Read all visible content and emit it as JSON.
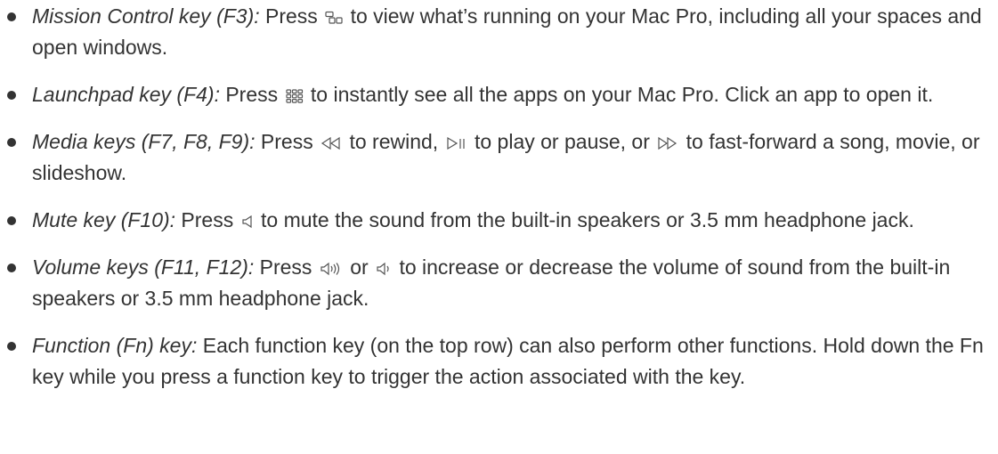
{
  "items": [
    {
      "term": "Mission Control key (F3):",
      "before": " Press ",
      "icon": "mission-control-icon",
      "after": " to view what’s running on your Mac Pro, including all your spaces and open windows."
    },
    {
      "term": "Launchpad key (F4):",
      "before": " Press ",
      "icon": "launchpad-icon",
      "after": " to instantly see all the apps on your Mac Pro. Click an app to open it."
    },
    {
      "term": "Media keys (F7, F8, F9):",
      "before": " Press ",
      "icon1": "rewind-icon",
      "mid1": " to rewind, ",
      "icon2": "play-pause-icon",
      "mid2": " to play or pause, or ",
      "icon3": "fast-forward-icon",
      "after": " to fast-forward a song, movie, or slideshow."
    },
    {
      "term": "Mute key (F10):",
      "before": " Press ",
      "icon": "mute-icon",
      "after": " to mute the sound from the built-in speakers or 3.5 mm headphone jack."
    },
    {
      "term": "Volume keys (F11, F12):",
      "before": " Press ",
      "icon1": "volume-up-icon",
      "mid1": " or ",
      "icon2": "volume-down-icon",
      "after": " to increase or decrease the volume of sound from the built-in speakers or 3.5 mm headphone jack."
    },
    {
      "term": "Function (Fn) key:",
      "after": " Each function key (on the top row) can also perform other functions. Hold down the Fn key while you press a function key to trigger the action associated with the key."
    }
  ]
}
